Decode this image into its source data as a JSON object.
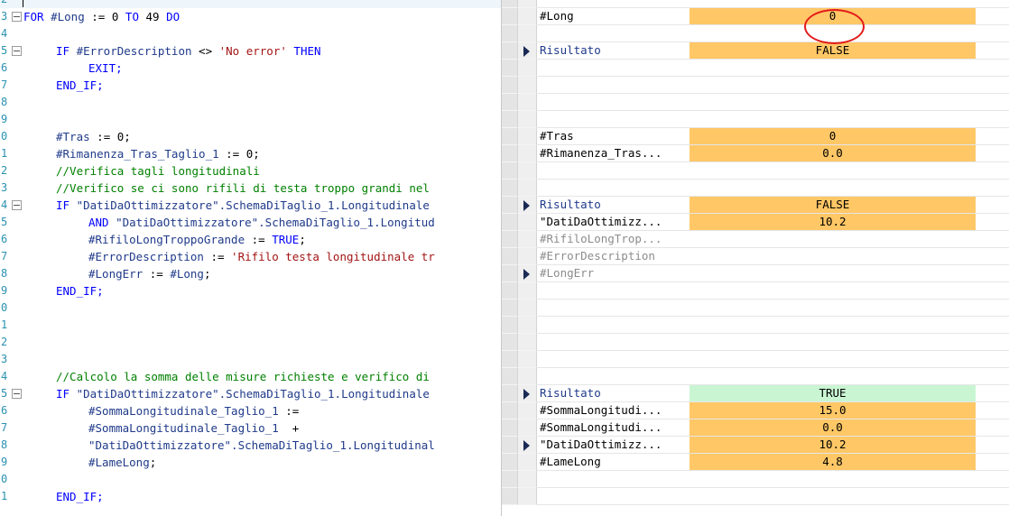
{
  "code_lines": [
    {
      "n": "2",
      "indent": 0,
      "tokens": []
    },
    {
      "n": "3",
      "indent": 0,
      "fold": true,
      "tokens": [
        {
          "t": "FOR ",
          "c": "kw"
        },
        {
          "t": "#Long",
          "c": "var"
        },
        {
          "t": " := ",
          "c": "plain"
        },
        {
          "t": "0",
          "c": "num"
        },
        {
          "t": " TO ",
          "c": "kw"
        },
        {
          "t": "49",
          "c": "num"
        },
        {
          "t": " DO",
          "c": "kw"
        }
      ]
    },
    {
      "n": "4",
      "indent": 0,
      "tokens": []
    },
    {
      "n": "5",
      "indent": 1,
      "fold": true,
      "tokens": [
        {
          "t": "IF ",
          "c": "kw"
        },
        {
          "t": "#ErrorDescription",
          "c": "var"
        },
        {
          "t": " <> ",
          "c": "plain"
        },
        {
          "t": "'No error'",
          "c": "str"
        },
        {
          "t": " THEN",
          "c": "kw"
        }
      ]
    },
    {
      "n": "6",
      "indent": 2,
      "tokens": [
        {
          "t": "EXIT;",
          "c": "kw"
        }
      ]
    },
    {
      "n": "7",
      "indent": 1,
      "tokens": [
        {
          "t": "END_IF;",
          "c": "kw"
        }
      ]
    },
    {
      "n": "8",
      "indent": 0,
      "tokens": []
    },
    {
      "n": "9",
      "indent": 0,
      "tokens": []
    },
    {
      "n": "0",
      "indent": 1,
      "tokens": [
        {
          "t": "#Tras",
          "c": "var"
        },
        {
          "t": " := ",
          "c": "plain"
        },
        {
          "t": "0",
          "c": "num"
        },
        {
          "t": ";",
          "c": "plain"
        }
      ]
    },
    {
      "n": "1",
      "indent": 1,
      "tokens": [
        {
          "t": "#Rimanenza_Tras_Taglio_1",
          "c": "var"
        },
        {
          "t": " := ",
          "c": "plain"
        },
        {
          "t": "0",
          "c": "num"
        },
        {
          "t": ";",
          "c": "plain"
        }
      ]
    },
    {
      "n": "2",
      "indent": 1,
      "tokens": [
        {
          "t": "//Verifica tagli longitudinali",
          "c": "cm"
        }
      ]
    },
    {
      "n": "3",
      "indent": 1,
      "tokens": [
        {
          "t": "//Verifico se ci sono rifili di testa troppo grandi nel",
          "c": "cm"
        }
      ]
    },
    {
      "n": "4",
      "indent": 1,
      "fold": true,
      "tokens": [
        {
          "t": "IF ",
          "c": "kw"
        },
        {
          "t": "\"DatiDaOttimizzatore\".SchemaDiTaglio_1.Longitudinale",
          "c": "var"
        }
      ]
    },
    {
      "n": "5",
      "indent": 2,
      "tokens": [
        {
          "t": "AND ",
          "c": "kw"
        },
        {
          "t": "\"DatiDaOttimizzatore\".SchemaDiTaglio_1.Longitud",
          "c": "var"
        }
      ]
    },
    {
      "n": "6",
      "indent": 2,
      "tokens": [
        {
          "t": "#RifiloLongTroppoGrande",
          "c": "var"
        },
        {
          "t": " := ",
          "c": "plain"
        },
        {
          "t": "TRUE",
          "c": "kw"
        },
        {
          "t": ";",
          "c": "plain"
        }
      ]
    },
    {
      "n": "7",
      "indent": 2,
      "tokens": [
        {
          "t": "#ErrorDescription",
          "c": "var"
        },
        {
          "t": " := ",
          "c": "plain"
        },
        {
          "t": "'Rifilo testa longitudinale tr",
          "c": "str"
        }
      ]
    },
    {
      "n": "8",
      "indent": 2,
      "tokens": [
        {
          "t": "#LongErr",
          "c": "var"
        },
        {
          "t": " := ",
          "c": "plain"
        },
        {
          "t": "#Long",
          "c": "var"
        },
        {
          "t": ";",
          "c": "plain"
        }
      ]
    },
    {
      "n": "9",
      "indent": 1,
      "tokens": [
        {
          "t": "END_IF;",
          "c": "kw"
        }
      ]
    },
    {
      "n": "0",
      "indent": 0,
      "tokens": []
    },
    {
      "n": "1",
      "indent": 0,
      "tokens": []
    },
    {
      "n": "2",
      "indent": 0,
      "tokens": []
    },
    {
      "n": "3",
      "indent": 0,
      "tokens": []
    },
    {
      "n": "4",
      "indent": 1,
      "tokens": [
        {
          "t": "//Calcolo la somma delle misure richieste e verifico di",
          "c": "cm"
        }
      ]
    },
    {
      "n": "5",
      "indent": 1,
      "fold": true,
      "tokens": [
        {
          "t": "IF ",
          "c": "kw"
        },
        {
          "t": "\"DatiDaOttimizzatore\".SchemaDiTaglio_1.Longitudinale",
          "c": "var"
        }
      ]
    },
    {
      "n": "6",
      "indent": 2,
      "tokens": [
        {
          "t": "#SommaLongitudinale_Taglio_1",
          "c": "var"
        },
        {
          "t": " :=",
          "c": "plain"
        }
      ]
    },
    {
      "n": "7",
      "indent": 2,
      "tokens": [
        {
          "t": "#SommaLongitudinale_Taglio_1",
          "c": "var"
        },
        {
          "t": "  +",
          "c": "plain"
        }
      ]
    },
    {
      "n": "8",
      "indent": 2,
      "tokens": [
        {
          "t": "\"DatiDaOttimizzatore\".SchemaDiTaglio_1.Longitudinal",
          "c": "var"
        }
      ]
    },
    {
      "n": "9",
      "indent": 2,
      "tokens": [
        {
          "t": "#LameLong",
          "c": "var"
        },
        {
          "t": ";",
          "c": "plain"
        }
      ]
    },
    {
      "n": "0",
      "indent": 0,
      "tokens": []
    },
    {
      "n": "1",
      "indent": 1,
      "tokens": [
        {
          "t": "END_IF;",
          "c": "kw"
        }
      ]
    }
  ],
  "monitor_rows": [
    {
      "arrow": false,
      "name": "",
      "value": "",
      "style": ""
    },
    {
      "arrow": false,
      "name": "#Long",
      "value": "0",
      "style": "orange",
      "nameColor": "plain"
    },
    {
      "arrow": false,
      "name": "",
      "value": "",
      "style": ""
    },
    {
      "arrow": true,
      "name": "Risultato",
      "value": "FALSE",
      "style": "orange",
      "nameColor": "blue"
    },
    {
      "arrow": false,
      "name": "",
      "value": "",
      "style": ""
    },
    {
      "arrow": false,
      "name": "",
      "value": "",
      "style": ""
    },
    {
      "arrow": false,
      "name": "",
      "value": "",
      "style": ""
    },
    {
      "arrow": false,
      "name": "",
      "value": "",
      "style": ""
    },
    {
      "arrow": false,
      "name": "#Tras",
      "value": "0",
      "style": "orange",
      "nameColor": "plain"
    },
    {
      "arrow": false,
      "name": "#Rimanenza_Tras...",
      "value": "0.0",
      "style": "orange",
      "nameColor": "plain"
    },
    {
      "arrow": false,
      "name": "",
      "value": "",
      "style": ""
    },
    {
      "arrow": false,
      "name": "",
      "value": "",
      "style": ""
    },
    {
      "arrow": true,
      "name": "Risultato",
      "value": "FALSE",
      "style": "orange",
      "nameColor": "blue"
    },
    {
      "arrow": false,
      "name": "\"DatiDaOttimizz...",
      "value": "10.2",
      "style": "orange",
      "nameColor": "plain"
    },
    {
      "arrow": false,
      "name": "#RifiloLongTrop...",
      "value": "",
      "style": "",
      "nameColor": "grey"
    },
    {
      "arrow": false,
      "name": "#ErrorDescription",
      "value": "",
      "style": "",
      "nameColor": "grey"
    },
    {
      "arrow": true,
      "name": "#LongErr",
      "value": "",
      "style": "",
      "nameColor": "grey"
    },
    {
      "arrow": false,
      "name": "",
      "value": "",
      "style": ""
    },
    {
      "arrow": false,
      "name": "",
      "value": "",
      "style": ""
    },
    {
      "arrow": false,
      "name": "",
      "value": "",
      "style": ""
    },
    {
      "arrow": false,
      "name": "",
      "value": "",
      "style": ""
    },
    {
      "arrow": false,
      "name": "",
      "value": "",
      "style": ""
    },
    {
      "arrow": false,
      "name": "",
      "value": "",
      "style": ""
    },
    {
      "arrow": true,
      "name": "Risultato",
      "value": "TRUE",
      "style": "green",
      "nameColor": "blue"
    },
    {
      "arrow": false,
      "name": "#SommaLongitudi...",
      "value": "15.0",
      "style": "orange",
      "nameColor": "plain"
    },
    {
      "arrow": false,
      "name": "#SommaLongitudi...",
      "value": "0.0",
      "style": "orange",
      "nameColor": "plain"
    },
    {
      "arrow": true,
      "name": "\"DatiDaOttimizz...",
      "value": "10.2",
      "style": "orange",
      "nameColor": "plain"
    },
    {
      "arrow": false,
      "name": "#LameLong",
      "value": "4.8",
      "style": "orange",
      "nameColor": "plain"
    },
    {
      "arrow": false,
      "name": "",
      "value": "",
      "style": ""
    },
    {
      "arrow": false,
      "name": "",
      "value": "",
      "style": ""
    }
  ],
  "colors": {
    "value_true_bg": "#c9f5d3",
    "value_bg": "#ffc766",
    "highlight_circle": "#e31a1a"
  }
}
